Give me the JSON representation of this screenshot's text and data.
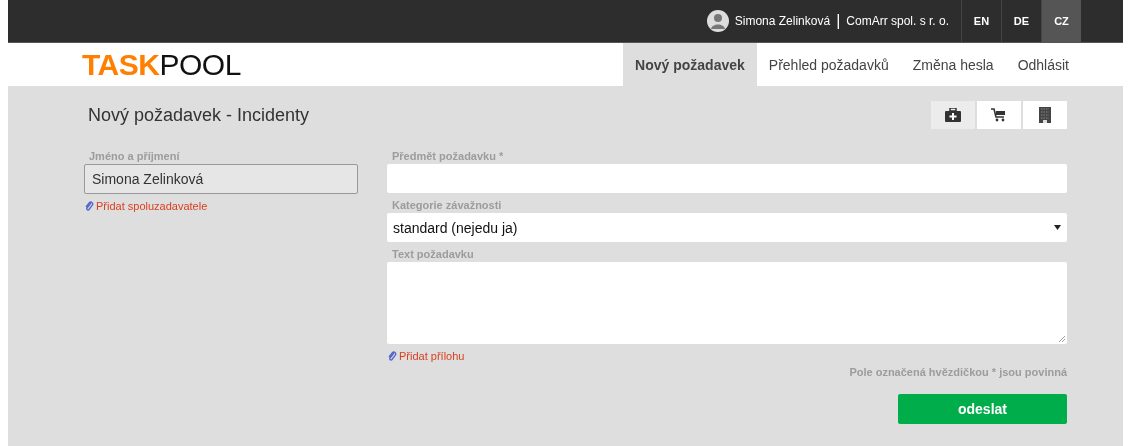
{
  "top_bar": {
    "user": "Simona Zelinková",
    "separator": "|",
    "company": "ComArr spol. s r. o.",
    "languages": [
      {
        "label": "EN",
        "selected": false
      },
      {
        "label": "DE",
        "selected": false
      },
      {
        "label": "CZ",
        "selected": true
      }
    ]
  },
  "logo": {
    "accent": "TASK",
    "rest": "POOL"
  },
  "nav": [
    {
      "label": "Nový požadavek",
      "selected": true
    },
    {
      "label": "Přehled požadavků",
      "selected": false
    },
    {
      "label": "Změna hesla",
      "selected": false
    },
    {
      "label": "Odhlásit",
      "selected": false
    }
  ],
  "page_title": "Nový požadavek - Incidenty",
  "category_buttons": [
    {
      "kind": "medkit",
      "selected": true
    },
    {
      "kind": "cart",
      "selected": false
    },
    {
      "kind": "building",
      "selected": false
    }
  ],
  "requester": {
    "label": "Jméno a příjmení",
    "value": "Simona Zelinková",
    "link": "Přidat spoluzadavatele"
  },
  "subject": {
    "label": "Předmět požadavku *"
  },
  "severity": {
    "label": "Kategorie závažnosti",
    "value": "standard (nejedu ja)"
  },
  "text": {
    "label": "Text požadavku"
  },
  "attachment_link": "Přidat přílohu",
  "required_note": "Pole označená hvězdičkou * jsou povinná",
  "submit": "odeslat"
}
